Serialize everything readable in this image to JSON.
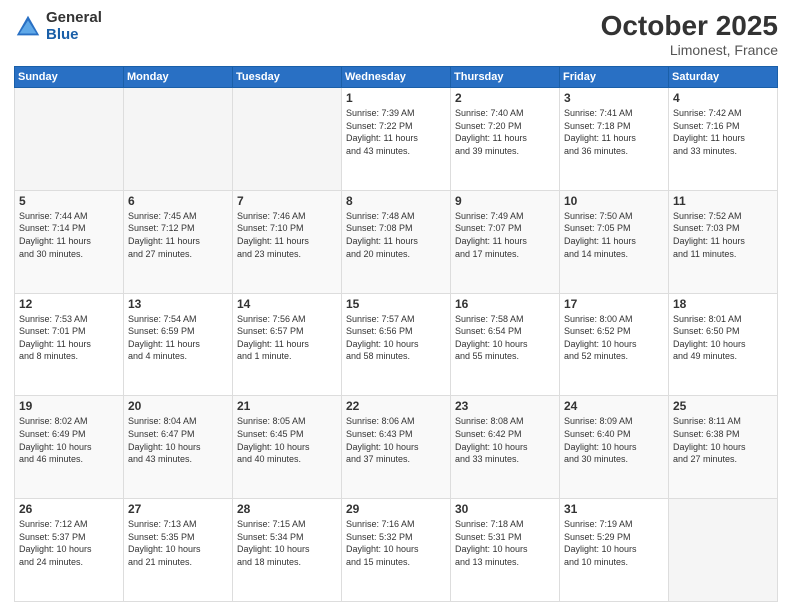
{
  "logo": {
    "general": "General",
    "blue": "Blue"
  },
  "header": {
    "month": "October 2025",
    "location": "Limonest, France"
  },
  "days_of_week": [
    "Sunday",
    "Monday",
    "Tuesday",
    "Wednesday",
    "Thursday",
    "Friday",
    "Saturday"
  ],
  "weeks": [
    [
      {
        "num": "",
        "info": "",
        "empty": true
      },
      {
        "num": "",
        "info": "",
        "empty": true
      },
      {
        "num": "",
        "info": "",
        "empty": true
      },
      {
        "num": "1",
        "info": "Sunrise: 7:39 AM\nSunset: 7:22 PM\nDaylight: 11 hours\nand 43 minutes.",
        "empty": false
      },
      {
        "num": "2",
        "info": "Sunrise: 7:40 AM\nSunset: 7:20 PM\nDaylight: 11 hours\nand 39 minutes.",
        "empty": false
      },
      {
        "num": "3",
        "info": "Sunrise: 7:41 AM\nSunset: 7:18 PM\nDaylight: 11 hours\nand 36 minutes.",
        "empty": false
      },
      {
        "num": "4",
        "info": "Sunrise: 7:42 AM\nSunset: 7:16 PM\nDaylight: 11 hours\nand 33 minutes.",
        "empty": false
      }
    ],
    [
      {
        "num": "5",
        "info": "Sunrise: 7:44 AM\nSunset: 7:14 PM\nDaylight: 11 hours\nand 30 minutes.",
        "empty": false
      },
      {
        "num": "6",
        "info": "Sunrise: 7:45 AM\nSunset: 7:12 PM\nDaylight: 11 hours\nand 27 minutes.",
        "empty": false
      },
      {
        "num": "7",
        "info": "Sunrise: 7:46 AM\nSunset: 7:10 PM\nDaylight: 11 hours\nand 23 minutes.",
        "empty": false
      },
      {
        "num": "8",
        "info": "Sunrise: 7:48 AM\nSunset: 7:08 PM\nDaylight: 11 hours\nand 20 minutes.",
        "empty": false
      },
      {
        "num": "9",
        "info": "Sunrise: 7:49 AM\nSunset: 7:07 PM\nDaylight: 11 hours\nand 17 minutes.",
        "empty": false
      },
      {
        "num": "10",
        "info": "Sunrise: 7:50 AM\nSunset: 7:05 PM\nDaylight: 11 hours\nand 14 minutes.",
        "empty": false
      },
      {
        "num": "11",
        "info": "Sunrise: 7:52 AM\nSunset: 7:03 PM\nDaylight: 11 hours\nand 11 minutes.",
        "empty": false
      }
    ],
    [
      {
        "num": "12",
        "info": "Sunrise: 7:53 AM\nSunset: 7:01 PM\nDaylight: 11 hours\nand 8 minutes.",
        "empty": false
      },
      {
        "num": "13",
        "info": "Sunrise: 7:54 AM\nSunset: 6:59 PM\nDaylight: 11 hours\nand 4 minutes.",
        "empty": false
      },
      {
        "num": "14",
        "info": "Sunrise: 7:56 AM\nSunset: 6:57 PM\nDaylight: 11 hours\nand 1 minute.",
        "empty": false
      },
      {
        "num": "15",
        "info": "Sunrise: 7:57 AM\nSunset: 6:56 PM\nDaylight: 10 hours\nand 58 minutes.",
        "empty": false
      },
      {
        "num": "16",
        "info": "Sunrise: 7:58 AM\nSunset: 6:54 PM\nDaylight: 10 hours\nand 55 minutes.",
        "empty": false
      },
      {
        "num": "17",
        "info": "Sunrise: 8:00 AM\nSunset: 6:52 PM\nDaylight: 10 hours\nand 52 minutes.",
        "empty": false
      },
      {
        "num": "18",
        "info": "Sunrise: 8:01 AM\nSunset: 6:50 PM\nDaylight: 10 hours\nand 49 minutes.",
        "empty": false
      }
    ],
    [
      {
        "num": "19",
        "info": "Sunrise: 8:02 AM\nSunset: 6:49 PM\nDaylight: 10 hours\nand 46 minutes.",
        "empty": false
      },
      {
        "num": "20",
        "info": "Sunrise: 8:04 AM\nSunset: 6:47 PM\nDaylight: 10 hours\nand 43 minutes.",
        "empty": false
      },
      {
        "num": "21",
        "info": "Sunrise: 8:05 AM\nSunset: 6:45 PM\nDaylight: 10 hours\nand 40 minutes.",
        "empty": false
      },
      {
        "num": "22",
        "info": "Sunrise: 8:06 AM\nSunset: 6:43 PM\nDaylight: 10 hours\nand 37 minutes.",
        "empty": false
      },
      {
        "num": "23",
        "info": "Sunrise: 8:08 AM\nSunset: 6:42 PM\nDaylight: 10 hours\nand 33 minutes.",
        "empty": false
      },
      {
        "num": "24",
        "info": "Sunrise: 8:09 AM\nSunset: 6:40 PM\nDaylight: 10 hours\nand 30 minutes.",
        "empty": false
      },
      {
        "num": "25",
        "info": "Sunrise: 8:11 AM\nSunset: 6:38 PM\nDaylight: 10 hours\nand 27 minutes.",
        "empty": false
      }
    ],
    [
      {
        "num": "26",
        "info": "Sunrise: 7:12 AM\nSunset: 5:37 PM\nDaylight: 10 hours\nand 24 minutes.",
        "empty": false
      },
      {
        "num": "27",
        "info": "Sunrise: 7:13 AM\nSunset: 5:35 PM\nDaylight: 10 hours\nand 21 minutes.",
        "empty": false
      },
      {
        "num": "28",
        "info": "Sunrise: 7:15 AM\nSunset: 5:34 PM\nDaylight: 10 hours\nand 18 minutes.",
        "empty": false
      },
      {
        "num": "29",
        "info": "Sunrise: 7:16 AM\nSunset: 5:32 PM\nDaylight: 10 hours\nand 15 minutes.",
        "empty": false
      },
      {
        "num": "30",
        "info": "Sunrise: 7:18 AM\nSunset: 5:31 PM\nDaylight: 10 hours\nand 13 minutes.",
        "empty": false
      },
      {
        "num": "31",
        "info": "Sunrise: 7:19 AM\nSunset: 5:29 PM\nDaylight: 10 hours\nand 10 minutes.",
        "empty": false
      },
      {
        "num": "",
        "info": "",
        "empty": true
      }
    ]
  ]
}
